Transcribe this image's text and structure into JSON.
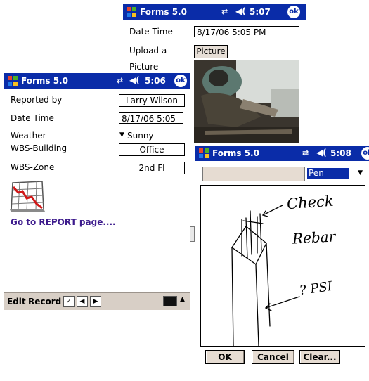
{
  "windows": {
    "upload": {
      "title": "Forms 5.0",
      "time": "5:07",
      "ok_label": "ok",
      "date_time_label": "Date Time",
      "date_time_value": "8/17/06 5:05 PM",
      "upload_label_line1": "Upload a",
      "upload_label_line2": "Picture",
      "picture_button": "Picture"
    },
    "report": {
      "title": "Forms 5.0",
      "time": "5:06",
      "ok_label": "ok",
      "reported_by_label": "Reported by",
      "reported_by_value": "Larry Wilson",
      "date_time_label": "Date Time",
      "date_time_value": "8/17/06 5:05",
      "weather_label": "Weather",
      "weather_value": "Sunny",
      "wbs_building_label": "WBS-Building",
      "wbs_building_value": "Office",
      "wbs_zone_label": "WBS-Zone",
      "wbs_zone_value": "2nd Fl",
      "report_link": "Go to REPORT page....",
      "toolbar": {
        "edit": "Edit",
        "record": "Record"
      }
    },
    "sketch": {
      "title": "Forms 5.0",
      "time": "5:08",
      "ok_label": "ok",
      "tool_select": "Pen",
      "ok_button": "OK",
      "cancel_button": "Cancel",
      "clear_button": "Clear...",
      "handwriting": {
        "line1": "Check",
        "line2": "Rebar",
        "line3": "? PSI"
      }
    }
  },
  "colors": {
    "titlebar": "#0a2ca8",
    "toolbar": "#d8cfc6",
    "link": "#3c1a8c",
    "button": "#e6dcd2"
  }
}
